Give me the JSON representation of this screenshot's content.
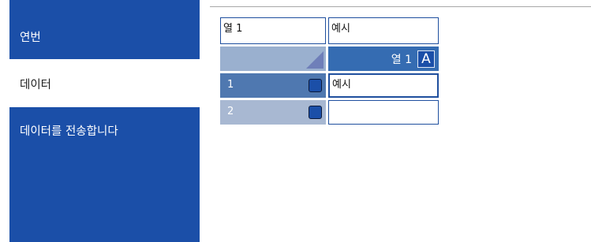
{
  "nav": [
    {
      "label": "연번",
      "active": false
    },
    {
      "label": "데이터",
      "active": true
    },
    {
      "label": "데이터를 전송합니다",
      "active": false
    }
  ],
  "columns_config": {
    "name_value": "열 1",
    "example_value": "예시"
  },
  "grid": {
    "column_header": "열 1",
    "column_type_icon": "A",
    "rows": [
      {
        "number": "1",
        "value": "예시"
      },
      {
        "number": "2",
        "value": ""
      }
    ]
  },
  "colors": {
    "brand_blue": "#1b4fa8",
    "header_blue": "#356cb2",
    "row_selected": "#4f78b0",
    "row_normal": "#a8b8d2"
  }
}
